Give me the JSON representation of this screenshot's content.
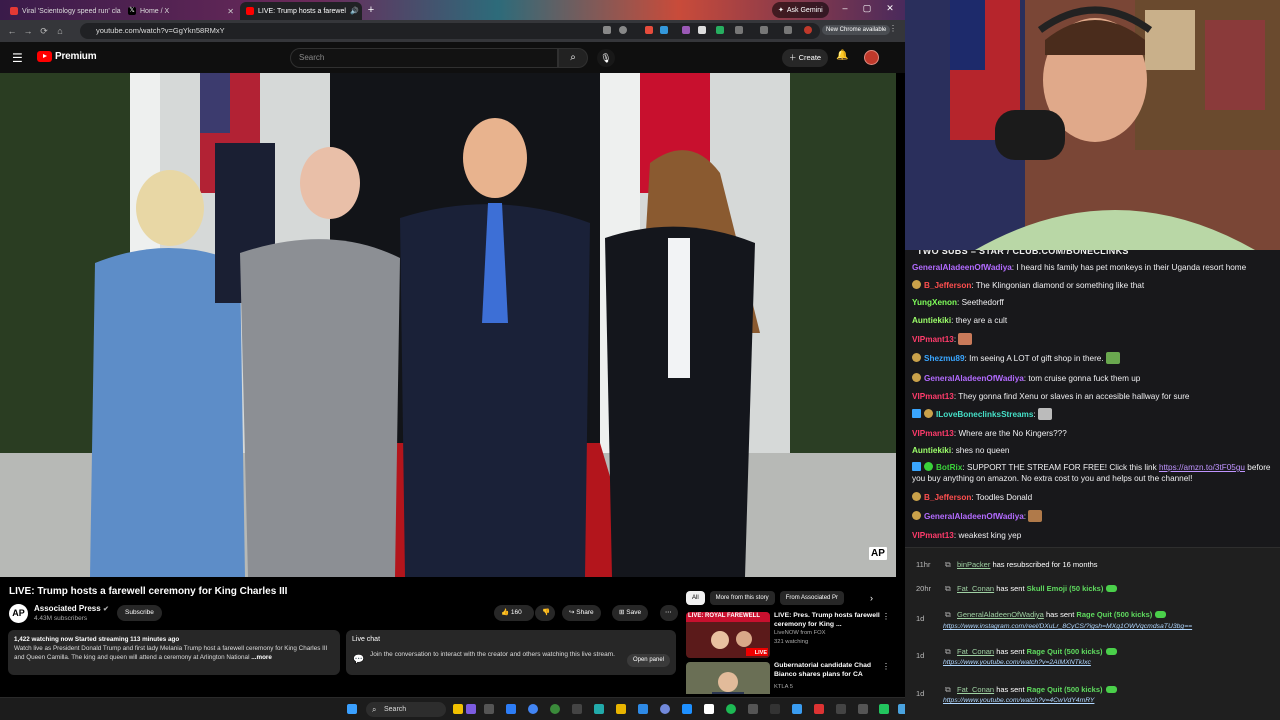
{
  "browser": {
    "tabs": [
      {
        "label": "Viral 'Scientology speed run' cla",
        "color": "#e53935"
      },
      {
        "label": "Home / X",
        "color": "#ffffff"
      },
      {
        "label": "LIVE: Trump hosts a farewel",
        "color": "#ff0000"
      }
    ],
    "new_tab": "+",
    "ask_gemini": "Ask Gemini",
    "url": "youtube.com/watch?v=GgYkn58RMxY",
    "new_chrome": "New Chrome available"
  },
  "youtube": {
    "logo": "Premium",
    "search_placeholder": "Search",
    "create_label": "Create",
    "video_title": "LIVE: Trump hosts a farewell ceremony for King Charles III",
    "channel": {
      "name": "Associated Press",
      "subs": "4.43M subscribers",
      "avatar_text": "AP"
    },
    "subscribe_label": "Subscribe",
    "likes": "160",
    "share_label": "Share",
    "save_label": "Save",
    "watermark": "AP",
    "description": {
      "stats": "1,422 watching now  Started streaming 113 minutes ago",
      "text": "Watch live as President Donald Trump and first lady Melania Trump host a farewell ceremony for King Charles III and Queen Camilla. The king and queen will attend a ceremony at Arlington National",
      "more": "...more"
    },
    "live_chat": {
      "heading": "Live chat",
      "text": "Join the conversation to interact with the creator and others watching this live stream.",
      "button": "Open panel"
    },
    "chips": [
      "All",
      "More from this story",
      "From Associated Pr"
    ],
    "recommendations": [
      {
        "thumb_label": "LIVE: ROYAL FAREWELL",
        "title": "LIVE: Pres. Trump hosts farewell ceremony for King ...",
        "channel": "LiveNOW from FOX",
        "meta": "321 watching",
        "badge": "LIVE"
      },
      {
        "title": "Gubernatorial candidate Chad Bianco shares plans for CA",
        "channel": "KTLA 5"
      }
    ]
  },
  "taskbar": {
    "search": "Search"
  },
  "stream": {
    "banner": "TWO SUBS = STAR / CLUB.COM/BONECLINKS",
    "chat": [
      {
        "user": "GeneralAladeenOfWadiya",
        "color": "#b36bff",
        "text": "I heard his family has pet monkeys in their Uganda resort home",
        "badge": false
      },
      {
        "user": "B_Jefferson",
        "color": "#ff4f4f",
        "text": "The Klingonian diamond or something like that",
        "badge": true
      },
      {
        "user": "YungXenon",
        "color": "#7fff5a",
        "text": "Seethedorff",
        "badge": false
      },
      {
        "user": "Auntiekiki",
        "color": "#9cff6a",
        "text": "they are a cult",
        "badge": false
      },
      {
        "user": "VIPmant13",
        "color": "#ff3b6b",
        "text": "",
        "badge": false,
        "emote": true
      },
      {
        "user": "Shezmu89",
        "color": "#3aa6ff",
        "text": "Im seeing A LOT of gift shop in there.",
        "badge": true,
        "emote": true
      },
      {
        "user": "GeneralAladeenOfWadiya",
        "color": "#b36bff",
        "text": "tom cruise gonna fuck them up",
        "badge": true
      },
      {
        "user": "VIPmant13",
        "color": "#ff3b6b",
        "text": "They gonna find Xenu or slaves in an accesible hallway for sure",
        "badge": false
      },
      {
        "user": "ILoveBoneclinksStreams",
        "color": "#45e0c8",
        "text": "",
        "badge": true,
        "emote": true
      },
      {
        "user": "VIPmant13",
        "color": "#ff3b6b",
        "text": "Where are the No Kingers???",
        "badge": false
      },
      {
        "user": "Auntiekiki",
        "color": "#9cff6a",
        "text": "shes no queen",
        "badge": false
      },
      {
        "user": "BotRix",
        "color": "#3ad13a",
        "text": "SUPPORT THE STREAM FOR FREE! Click this link",
        "link": "https://amzn.to/3tF05gu",
        "text2": "before you buy anything on amazon. No extra cost to you and helps out the channel!",
        "badge": true
      },
      {
        "user": "B_Jefferson",
        "color": "#ff4f4f",
        "text": "Toodles Donald",
        "badge": true
      },
      {
        "user": "GeneralAladeenOfWadiya",
        "color": "#b36bff",
        "text": "",
        "badge": true,
        "emote": true
      },
      {
        "user": "VIPmant13",
        "color": "#ff3b6b",
        "text": "weakest king yep",
        "badge": false
      }
    ],
    "events": [
      {
        "time": "11hr",
        "name": "binPacker",
        "action": "has resubscribed for 16 months"
      },
      {
        "time": "20hr",
        "name": "Fat_Conan",
        "action": "has sent",
        "gift": "Skull Emoji (50 kicks)"
      },
      {
        "time": "1d",
        "name": "GeneralAladeenOfWadiya",
        "action": "has sent",
        "gift": "Rage Quit (500 kicks)",
        "link": "https://www.instagram.com/reel/DXuLr_8CyCS/?igsh=MXg1OWVqcmdsaTU3bg=="
      },
      {
        "time": "1d",
        "name": "Fat_Conan",
        "action": "has sent",
        "gift": "Rage Quit (500 kicks)",
        "link": "https://www.youtube.com/watch?v=2AIMXNTkIxc"
      },
      {
        "time": "1d",
        "name": "Fat_Conan",
        "action": "has sent",
        "gift": "Rage Quit (500 kicks)",
        "link": "https://www.youtube.com/watch?v=4CwVdY4mRY"
      }
    ]
  }
}
